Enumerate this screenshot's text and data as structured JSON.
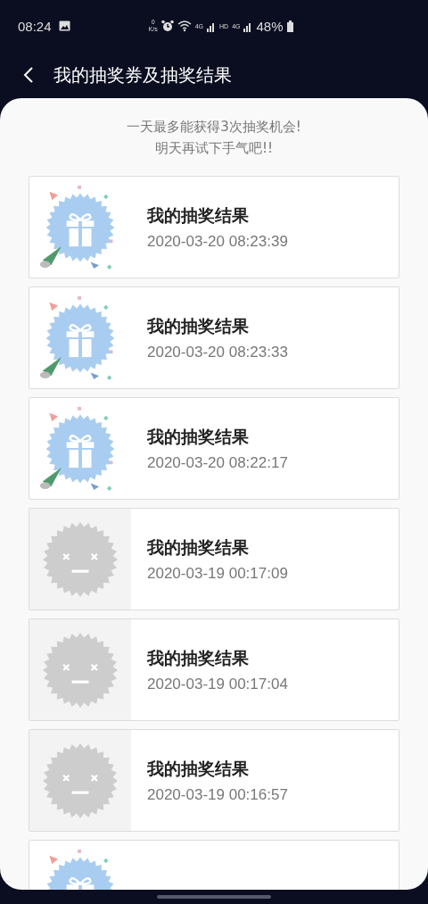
{
  "status_bar": {
    "time": "08:24",
    "net_speed_value": "0",
    "net_speed_unit": "K/s",
    "network_1": "4G",
    "hd": "HD",
    "network_2": "4G",
    "battery": "48%"
  },
  "header": {
    "title": "我的抽奖券及抽奖结果"
  },
  "notice": [
    "一天最多能获得3次抽奖机会!",
    "明天再试下手气吧!!"
  ],
  "results": [
    {
      "kind": "win",
      "title": "我的抽奖结果",
      "time": "2020-03-20 08:23:39"
    },
    {
      "kind": "win",
      "title": "我的抽奖结果",
      "time": "2020-03-20 08:23:33"
    },
    {
      "kind": "win",
      "title": "我的抽奖结果",
      "time": "2020-03-20 08:22:17"
    },
    {
      "kind": "none",
      "title": "我的抽奖结果",
      "time": "2020-03-19 00:17:09"
    },
    {
      "kind": "none",
      "title": "我的抽奖结果",
      "time": "2020-03-19 00:17:04"
    },
    {
      "kind": "none",
      "title": "我的抽奖结果",
      "time": "2020-03-19 00:16:57"
    },
    {
      "kind": "win"
    }
  ]
}
